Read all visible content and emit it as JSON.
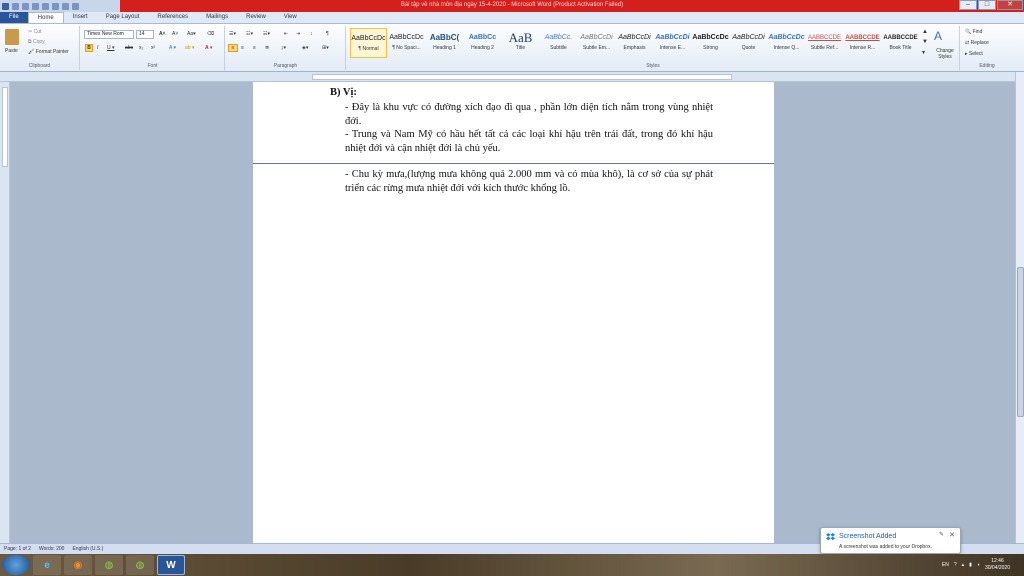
{
  "window": {
    "title": "Bài tập về nhà môn địa ngày 15-4-2020 - Microsoft Word (Product Activation Failed)"
  },
  "tabs": [
    {
      "label": "File"
    },
    {
      "label": "Home"
    },
    {
      "label": "Insert"
    },
    {
      "label": "Page Layout"
    },
    {
      "label": "References"
    },
    {
      "label": "Mailings"
    },
    {
      "label": "Review"
    },
    {
      "label": "View"
    }
  ],
  "ribbon": {
    "clipboard": {
      "paste": "Paste",
      "cut": "Cut",
      "copy": "Copy",
      "format_painter": "Format Painter",
      "label": "Clipboard"
    },
    "font": {
      "name": "Times New Rom",
      "size": "14",
      "label": "Font"
    },
    "paragraph": {
      "label": "Paragraph"
    },
    "styles": {
      "label": "Styles",
      "items": [
        {
          "sample": "AaBbCcDc",
          "name": "¶ Normal"
        },
        {
          "sample": "AaBbCcDc",
          "name": "¶ No Spaci..."
        },
        {
          "sample": "AaBbC(",
          "name": "Heading 1"
        },
        {
          "sample": "AaBbCc",
          "name": "Heading 2"
        },
        {
          "sample": "AaB",
          "name": "Title"
        },
        {
          "sample": "AaBbCc.",
          "name": "Subtitle"
        },
        {
          "sample": "AaBbCcDi",
          "name": "Subtle Em..."
        },
        {
          "sample": "AaBbCcDi",
          "name": "Emphasis"
        },
        {
          "sample": "AaBbCcDi",
          "name": "Intense E..."
        },
        {
          "sample": "AaBbCcDc",
          "name": "Strong"
        },
        {
          "sample": "AaBbCcDi",
          "name": "Quote"
        },
        {
          "sample": "AaBbCcDc",
          "name": "Intense Q..."
        },
        {
          "sample": "AABBCCDE",
          "name": "Subtle Ref..."
        },
        {
          "sample": "AABBCCDE",
          "name": "Intense R..."
        },
        {
          "sample": "AABBCCDE",
          "name": "Book Title"
        }
      ],
      "change_styles": "Change Styles"
    },
    "editing": {
      "find": "Find",
      "replace": "Replace",
      "select": "Select",
      "label": "Editing"
    }
  },
  "document": {
    "heading": "B) Vị:",
    "paragraphs": [
      "- Đây là khu vực có đường xích đạo đi qua , phần lớn diện tích nằm trong vùng nhiệt đới.",
      "- Trung và Nam Mỹ có hầu hết tất cả các loại khí hậu trên trái đất, trong đó khí hậu nhiệt đới và cận nhiệt đới là chủ yếu.",
      "- Chu kỳ mưa,(lượng mưa không quá 2.000 mm và có mùa khô), là cơ sở của sự phát triển các rừng mưa nhiệt đới với kích thước khổng lồ."
    ]
  },
  "status": {
    "page": "Page: 1 of 2",
    "words": "Words: 200",
    "language": "English (U.S.)"
  },
  "notification": {
    "title": "Screenshot Added",
    "message": "A screenshot was added to your Dropbox."
  },
  "tray": {
    "lang": "EN",
    "time": "12:46",
    "date": "30/04/2020"
  }
}
